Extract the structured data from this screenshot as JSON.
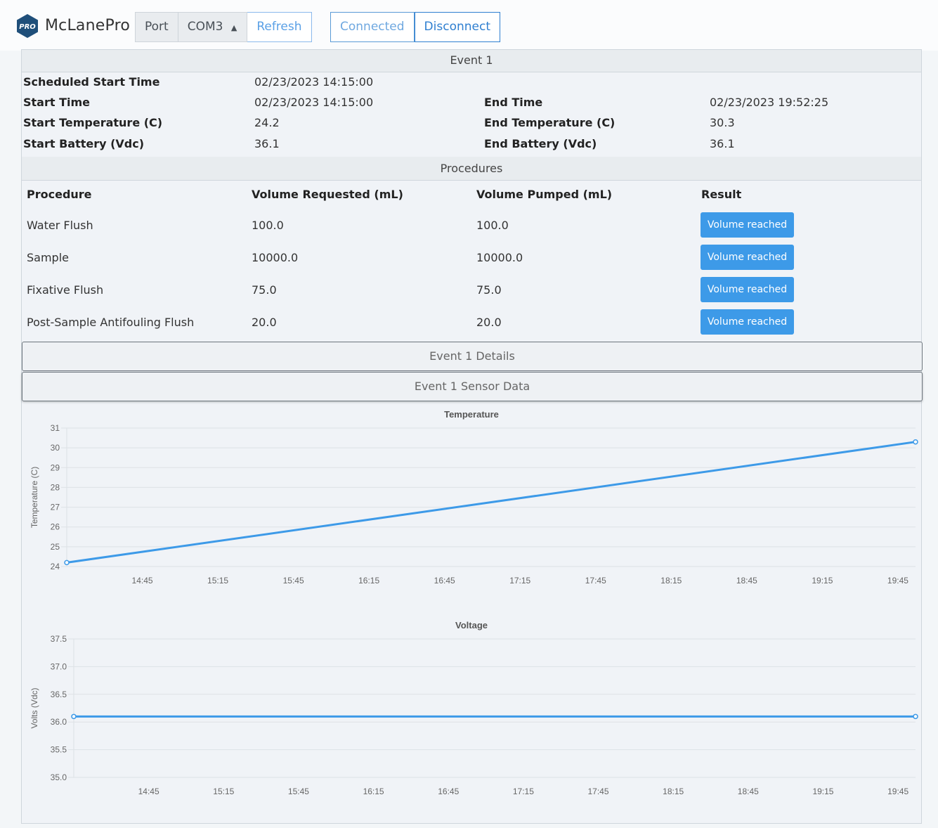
{
  "app": {
    "brand": "McLanePro",
    "logo_text": "PRO",
    "port_label": "Port",
    "port_value": "COM3",
    "refresh_label": "Refresh",
    "connected_label": "Connected",
    "disconnect_label": "Disconnect"
  },
  "event": {
    "title": "Event 1",
    "scheduled_start_label": "Scheduled Start Time",
    "scheduled_start_value": "02/23/2023 14:15:00",
    "start_time_label": "Start Time",
    "start_time_value": "02/23/2023 14:15:00",
    "start_temp_label": "Start Temperature (C)",
    "start_temp_value": "24.2",
    "start_batt_label": "Start Battery (Vdc)",
    "start_batt_value": "36.1",
    "end_time_label": "End Time",
    "end_time_value": "02/23/2023 19:52:25",
    "end_temp_label": "End Temperature (C)",
    "end_temp_value": "30.3",
    "end_batt_label": "End Battery (Vdc)",
    "end_batt_value": "36.1"
  },
  "procedures": {
    "title": "Procedures",
    "headers": [
      "Procedure",
      "Volume Requested (mL)",
      "Volume Pumped (mL)",
      "Result"
    ],
    "rows": [
      {
        "name": "Water Flush",
        "requested": "100.0",
        "pumped": "100.0",
        "result": "Volume reached"
      },
      {
        "name": "Sample",
        "requested": "10000.0",
        "pumped": "10000.0",
        "result": "Volume reached"
      },
      {
        "name": "Fixative Flush",
        "requested": "75.0",
        "pumped": "75.0",
        "result": "Volume reached"
      },
      {
        "name": "Post-Sample Antifouling Flush",
        "requested": "20.0",
        "pumped": "20.0",
        "result": "Volume reached"
      }
    ]
  },
  "details_label": "Event 1 Details",
  "sensor_label": "Event 1 Sensor Data",
  "colors": {
    "series": "#3d9ae8",
    "badge": "#3d9ae8",
    "accent": "#2f7fd0"
  },
  "chart_data": [
    {
      "type": "line",
      "title": "Temperature",
      "ylabel": "Temperature (C)",
      "xlabel": "",
      "ylim": [
        24,
        31
      ],
      "yticks": [
        "24",
        "25",
        "26",
        "27",
        "28",
        "29",
        "30",
        "31"
      ],
      "xticks": [
        "14:45",
        "15:15",
        "15:45",
        "16:15",
        "16:45",
        "17:15",
        "17:45",
        "18:15",
        "18:45",
        "19:15",
        "19:45"
      ],
      "series": [
        {
          "x": [
            "14:15",
            "19:52"
          ],
          "values": [
            24.2,
            30.3
          ]
        }
      ],
      "grid": true
    },
    {
      "type": "line",
      "title": "Voltage",
      "ylabel": "Volts (Vdc)",
      "xlabel": "",
      "ylim": [
        35.0,
        37.5
      ],
      "yticks": [
        "35.0",
        "35.5",
        "36.0",
        "36.5",
        "37.0",
        "37.5"
      ],
      "xticks": [
        "14:45",
        "15:15",
        "15:45",
        "16:15",
        "16:45",
        "17:15",
        "17:45",
        "18:15",
        "18:45",
        "19:15",
        "19:45"
      ],
      "series": [
        {
          "x": [
            "14:15",
            "19:52"
          ],
          "values": [
            36.1,
            36.1
          ]
        }
      ],
      "grid": true
    }
  ]
}
